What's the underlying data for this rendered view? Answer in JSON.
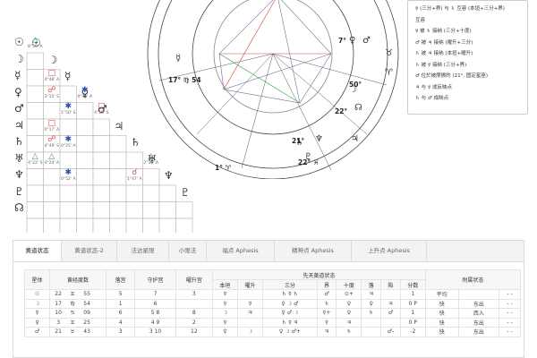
{
  "aspect_grid": {
    "rows": [
      {
        "glyph": "☉",
        "name": "sun"
      },
      {
        "glyph": "☽",
        "name": "moon"
      },
      {
        "glyph": "☿",
        "name": "mercury"
      },
      {
        "glyph": "♀",
        "name": "venus"
      },
      {
        "glyph": "♂",
        "name": "mars"
      },
      {
        "glyph": "♃",
        "name": "jupiter"
      },
      {
        "glyph": "♄",
        "name": "saturn"
      },
      {
        "glyph": "♅",
        "name": "uranus"
      },
      {
        "glyph": "♆",
        "name": "neptune"
      },
      {
        "glyph": "♇",
        "name": "pluto"
      },
      {
        "glyph": "☊",
        "name": "node"
      }
    ],
    "diagonal": [
      {
        "row": 0,
        "glyph": "☉"
      },
      {
        "row": 1,
        "glyph": "☽"
      },
      {
        "row": 2,
        "glyph": "☿"
      },
      {
        "row": 3,
        "glyph": "♀"
      },
      {
        "row": 4,
        "glyph": "♂"
      },
      {
        "row": 5,
        "glyph": "♃"
      },
      {
        "row": 6,
        "glyph": "♄"
      },
      {
        "row": 7,
        "glyph": "♅"
      },
      {
        "row": 8,
        "glyph": "♆"
      },
      {
        "row": 9,
        "glyph": "♇"
      }
    ],
    "cells": [
      {
        "row": 1,
        "col": 0,
        "symbol": "△",
        "color": "#2e9e44",
        "label": "8°59' A"
      },
      {
        "row": 3,
        "col": 1,
        "symbol": "□",
        "color": "#d9443a",
        "label": "4°48' A"
      },
      {
        "row": 4,
        "col": 1,
        "symbol": "☍",
        "color": "#d9443a",
        "label": "3°15' S"
      },
      {
        "row": 4,
        "col": 3,
        "symbol": "✱",
        "color": "#2f4fb3",
        "label": "0°41' A"
      },
      {
        "row": 5,
        "col": 2,
        "symbol": "✱",
        "color": "#2f4fb3",
        "label": "1°50' S"
      },
      {
        "row": 5,
        "col": 4,
        "symbol": "□",
        "color": "#d9443a",
        "label": "4°56' S"
      },
      {
        "row": 6,
        "col": 1,
        "symbol": "□",
        "color": "#d9443a",
        "label": "0°17' A"
      },
      {
        "row": 7,
        "col": 1,
        "symbol": "☍",
        "color": "#d9443a",
        "label": "4°49' S"
      },
      {
        "row": 7,
        "col": 2,
        "symbol": "✱",
        "color": "#2f4fb3",
        "label": "0°25' A"
      },
      {
        "row": 8,
        "col": 0,
        "symbol": "△",
        "color": "#2e9e44",
        "label": "4°22' S"
      },
      {
        "row": 8,
        "col": 1,
        "symbol": "△",
        "color": "#2e9e44",
        "label": "4°24' A"
      },
      {
        "row": 8,
        "col": 7,
        "symbol": "△",
        "color": "#2e9e44",
        "label": "2°35' A"
      },
      {
        "row": 9,
        "col": 2,
        "symbol": "✱",
        "color": "#2f4fb3",
        "label": "0°52' A"
      },
      {
        "row": 9,
        "col": 6,
        "symbol": "☌",
        "color": "#c14a8c",
        "label": "1°47' A"
      }
    ]
  },
  "wheel": {
    "inner_labels": [
      {
        "text": "17° ♍ 54",
        "name": "moon-degree-label"
      },
      {
        "text": "50°",
        "name": "degree-label-50"
      },
      {
        "text": "22°",
        "name": "degree-label-22"
      },
      {
        "text": "22° ♓",
        "name": "degree-label-22-pisces"
      },
      {
        "text": "21°",
        "name": "degree-label-21"
      },
      {
        "text": "7°",
        "name": "degree-label-7"
      },
      {
        "text": "1° ♈",
        "name": "aries-degree-label"
      }
    ]
  },
  "legend": {
    "lines": [
      "☿ (三分+界) 与 ♄ 互容 (本垣+三分+界)",
      "互容",
      "☿ 被 ♄ 接纳 (三分+十度)",
      "♂ 被 ♃ 接纳 (曜升+三分)",
      "♄ 被 ♃ 接纳 (本垣+曜升)",
      "♄ 被 ☿ 接纳 (三分+界)",
      "♂ 位於被摩擦的 (21°, 固定星座)",
      "♃ 与 ☿ 成反映点",
      "♄ 与 ♂ 成映点"
    ]
  },
  "tabs": [
    "黄道状态",
    "黄道状态-2",
    "法达星限",
    "小限法",
    "福点 Aphesis",
    "精神点 Aphesis",
    "上升点 Aphesis"
  ],
  "table": {
    "headers": {
      "planet": "星体",
      "longitude": "黄经度数",
      "house": "落宫",
      "ruled": "守护宫",
      "exalted": "曜升宫",
      "group": "先天黄道状态",
      "sub": [
        "本垣",
        "曜升",
        "三分",
        "界",
        "十度",
        "落",
        "陷",
        "分数"
      ],
      "accidental": "附属状态"
    },
    "rows": [
      {
        "planet": "☉",
        "deg": "22",
        "sign": "♊",
        "min": "55",
        "house": "5",
        "ruled": "7",
        "exalted": "3",
        "domicile": "☿",
        "exalt": "",
        "triplicity": "♄ ☿ ♄",
        "term": "♂",
        "face": "⊙+",
        "fall": "♃",
        "detriment": "",
        "score": "1",
        "state": "平均",
        "acc": "",
        "mark": "- -"
      },
      {
        "planet": "☽",
        "deg": "17",
        "sign": "♍",
        "min": "54",
        "house": "1",
        "ruled": "6",
        "exalted": "",
        "domicile": "☿",
        "exalt": "☿",
        "triplicity": "♀ ☽ ♂",
        "term": "♄",
        "face": "♀",
        "fall": "♀",
        "detriment": "♃",
        "score": "0 P",
        "state": "快",
        "acc": "东出",
        "mark": "- -"
      },
      {
        "planet": "☿",
        "deg": "10",
        "sign": "♋",
        "min": "09",
        "house": "6",
        "ruled": "5 8",
        "exalted": "8",
        "domicile": "☽",
        "exalt": "♃",
        "triplicity": "♀ ♂ ☽",
        "term": "☿+",
        "face": "♀",
        "fall": "♄",
        "detriment": "♂",
        "score": "1",
        "state": "快",
        "acc": "西入",
        "mark": "- -"
      },
      {
        "planet": "♀",
        "deg": "3",
        "sign": "♊",
        "min": "25",
        "house": "4",
        "ruled": "4 9",
        "exalted": "2",
        "domicile": "☿",
        "exalt": "",
        "triplicity": "♄ ☿ ♃",
        "term": "☿",
        "face": "♃",
        "fall": "",
        "detriment": "",
        "score": "0 P",
        "state": "快",
        "acc": "东出",
        "mark": "- -"
      },
      {
        "planet": "♂",
        "deg": "21",
        "sign": "♉",
        "min": "43",
        "house": "3",
        "ruled": "3 10",
        "exalted": "12",
        "domicile": "♀",
        "exalt": "☽",
        "triplicity": "♀ ☽ ♂+",
        "term": "♃",
        "face": "♄",
        "fall": "",
        "detriment": "♂-",
        "score": "-2",
        "state": "快",
        "acc": "东出",
        "mark": "- -"
      }
    ]
  }
}
